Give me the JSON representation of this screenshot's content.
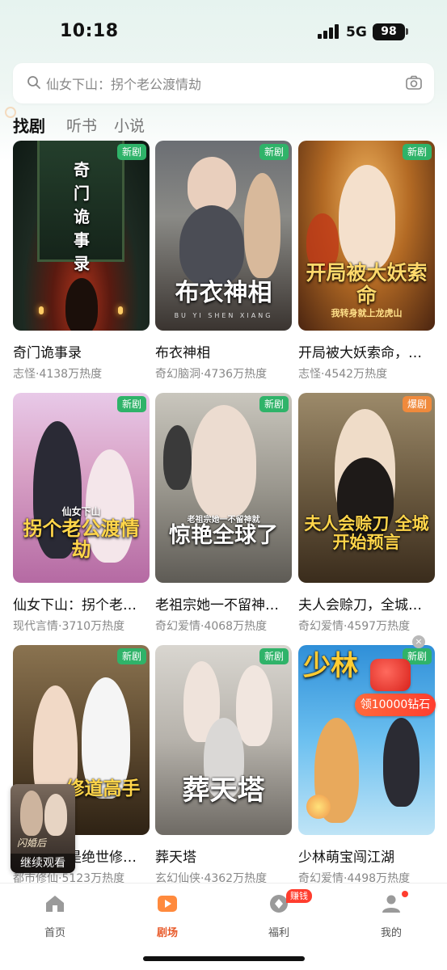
{
  "status_bar": {
    "time": "10:18",
    "network": "5G",
    "battery": "98"
  },
  "search": {
    "placeholder": "仙女下山：拐个老公渡情劫"
  },
  "tabs": [
    {
      "label": "找剧",
      "active": true
    },
    {
      "label": "听书",
      "active": false
    },
    {
      "label": "小说",
      "active": false
    }
  ],
  "cards": [
    {
      "title": "奇门诡事录",
      "meta": "志怪·4138万热度",
      "badge": "新剧",
      "poster_text": "奇门诡事录"
    },
    {
      "title": "布衣神相",
      "meta": "奇幻脑洞·4736万热度",
      "badge": "新剧",
      "poster_text": "布衣神相",
      "poster_sub": "BU YI SHEN XIANG"
    },
    {
      "title": "开局被大妖索命，我转身就上龙虎山",
      "meta": "志怪·4542万热度",
      "badge": "新剧",
      "poster_text": "开局被大妖索命",
      "poster_sub": "我转身就上龙虎山"
    },
    {
      "title": "仙女下山：拐个老公渡情劫",
      "meta": "现代言情·3710万热度",
      "badge": "新剧",
      "poster_text": "拐个老公渡情劫",
      "poster_sub": "仙女下山"
    },
    {
      "title": "老祖宗她一不留神就惊艳全球了",
      "meta": "奇幻爱情·4068万热度",
      "badge": "新剧",
      "poster_text": "惊艳全球了",
      "poster_sub": "老祖宗她一不留神就"
    },
    {
      "title": "夫人会赊刀，全城开始预言",
      "meta": "奇幻爱情·4597万热度",
      "badge": "爆剧",
      "poster_text": "夫人会赊刀 全城开始预言"
    },
    {
      "title": "都市之我是绝世修道高手",
      "meta": "都市修仙·5123万热度",
      "badge": "新剧",
      "poster_text": "修道高手"
    },
    {
      "title": "葬天塔",
      "meta": "玄幻仙侠·4362万热度",
      "badge": "新剧",
      "poster_text": "葬天塔"
    },
    {
      "title": "少林萌宝闯江湖",
      "meta": "奇幻爱情·4498万热度",
      "badge": "新剧",
      "poster_text": "少林"
    }
  ],
  "continue_watching": {
    "label": "继续观看",
    "poster_text": "闪婚后"
  },
  "promo": {
    "label": "领10000钻石",
    "close": "×"
  },
  "bottom_nav": [
    {
      "label": "首页",
      "icon": "home-icon",
      "active": false
    },
    {
      "label": "剧场",
      "icon": "theater-play-icon",
      "active": true
    },
    {
      "label": "福利",
      "icon": "coin-icon",
      "active": false,
      "badge": "赚钱"
    },
    {
      "label": "我的",
      "icon": "profile-icon",
      "active": false
    }
  ],
  "colors": {
    "accent": "#e85a2a",
    "badge_new": "#2fb369",
    "badge_hot": "#f08a3c"
  }
}
